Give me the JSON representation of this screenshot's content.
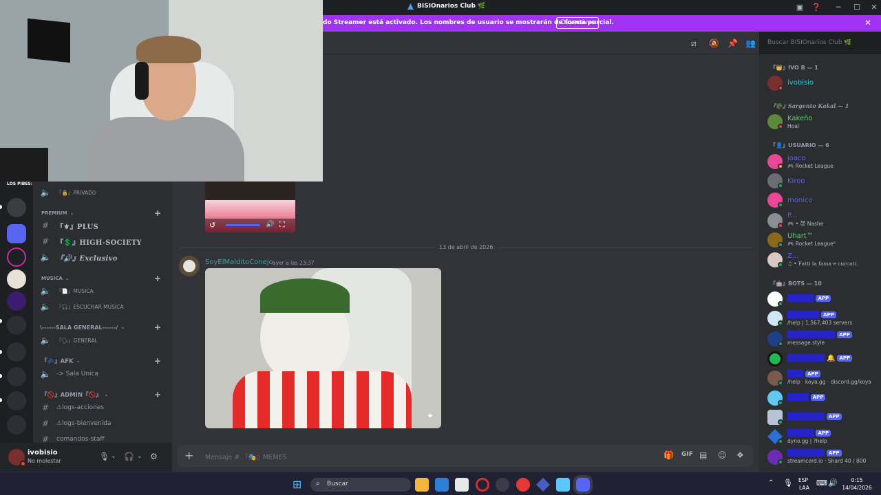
{
  "titlebar": {
    "title": "BISIOnarios Club",
    "title_icon": "🌿"
  },
  "banner": {
    "text": "do Streamer está activado. Los nombres de usuario se mostrarán de forma parcial.",
    "button": "Desactivar"
  },
  "search": {
    "placeholder": "Buscar BISIOnarios Club 🌿"
  },
  "servers": {
    "first_label": "LOS PIBES:"
  },
  "channels": {
    "privado": "PRIVADO",
    "cat_premium": "PREMIUM",
    "plus": "PLUS",
    "high_society": "HIGH-SOCIETY",
    "exclusivo": "Exclusivo",
    "cat_musica": "MUSICA",
    "musica": "MUSICA",
    "escuchar": "ESCUCHAR MUSICA",
    "cat_sala": "\\------SALA GENERAL------/",
    "general": "GENERAL",
    "cat_afk": "AFK",
    "sala_unica": "-> Sala Unica",
    "cat_admin": "ADMIN",
    "logs_acciones": "⚠logs-acciones",
    "logs_bienvenida": "⚠logs-bienvenida",
    "comandos_staff": "comandos-staff"
  },
  "user": {
    "name": "ivobisio",
    "status": "No molestar"
  },
  "chat": {
    "date": "13 de abril de 2026",
    "author": "SoyElMalditoConejo",
    "time": "ayer a las 23:37",
    "composer_placeholder": "Mensaje # 『🎭』MEMES"
  },
  "members": {
    "cat1": "IVO B — 1",
    "m1_name": "ivobisio",
    "cat2": "Sargento Kakal — 1",
    "m2_name": "Kakeño",
    "m2_sub": "Hoal",
    "cat3": "USUARIO — 6",
    "m3_name": "joaco",
    "m3_sub": "Rocket League",
    "m4_name": "Kiroo",
    "m5_name": "monico",
    "m6_name": "P...",
    "m6_sub": "• 😈 Nashe",
    "m7_name": "Uhart™",
    "m7_sub": "Rocket League⁸",
    "m8_name": "Z...",
    "m8_sub": "♫ • Fatti la fama e curcati.",
    "cat4": "BOTS — 10",
    "app": "APP",
    "b2_sub": "/help | 1,567,403 servers",
    "b3_sub": "message.style",
    "b5_sub": "/help · koya.gg · discord.gg/koya",
    "b8_sub": "dyno.gg | ?help",
    "b9_sub": "streamcord.io · Shard 40 / 800"
  },
  "taskbar": {
    "search": "Buscar",
    "lang": "ESP",
    "lang2": "LAA",
    "time": "0:15",
    "date": "14/04/2026"
  },
  "colors": {
    "banner": "#a033f2",
    "accent": "#5865f2",
    "dnd": "#f23f43",
    "online": "#23a55a",
    "idle": "#f0b232"
  }
}
